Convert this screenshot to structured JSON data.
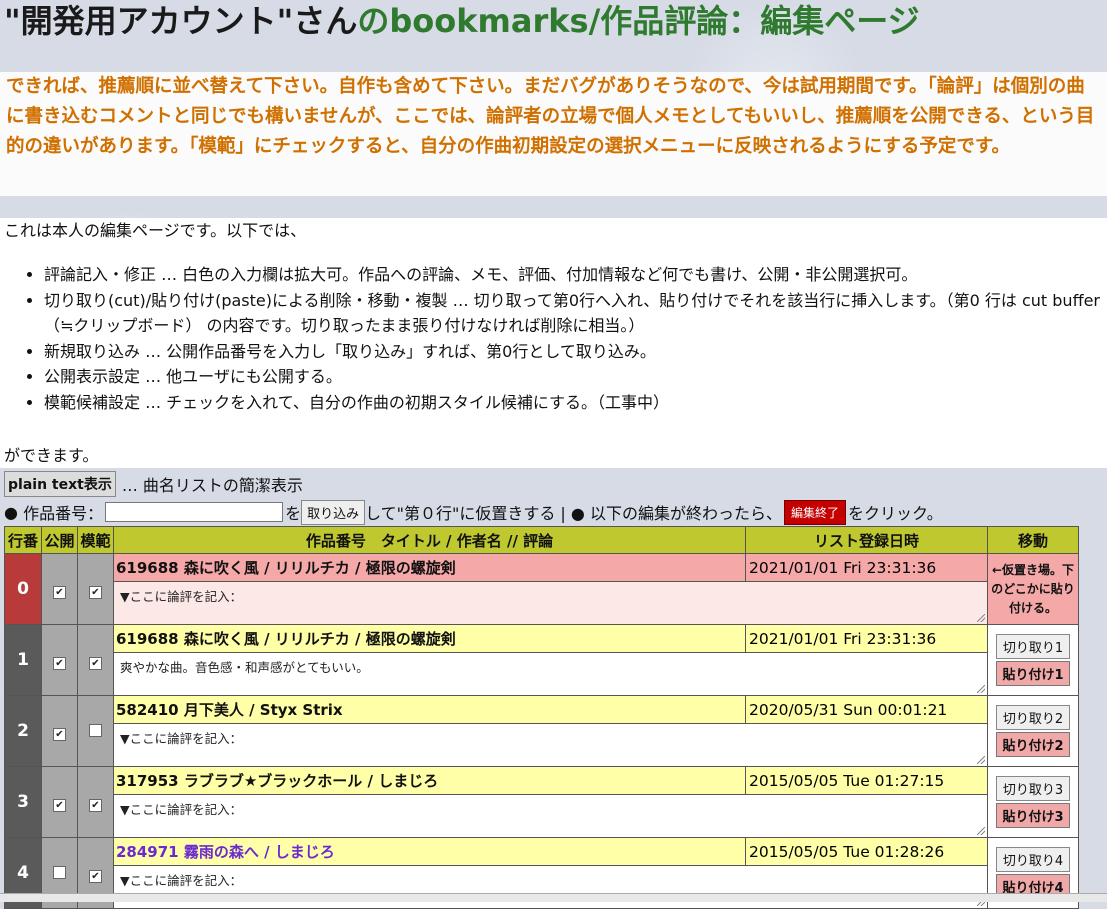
{
  "title": {
    "owner": "\"開発用アカウント\"さん",
    "rest": "のbookmarks/作品評論：編集ページ"
  },
  "notice": "できれば、推薦順に並べ替えて下さい。自作も含めて下さい。まだバグがありそうなので、今は試用期間です。「論評」は個別の曲に書き込むコメントと同じでも構いませんが、ここでは、論評者の立場で個人メモとしてもいいし、推薦順を公開できる、という目的の違いがあります。「模範」にチェックすると、自分の作曲初期設定の選択メニューに反映されるようにする予定です。",
  "intro": {
    "lead": "これは本人の編集ページです。以下では、",
    "items": [
      "評論記入・修正 … 白色の入力欄は拡大可。作品への評論、メモ、評価、付加情報など何でも書け、公開・非公開選択可。",
      "切り取り(cut)/貼り付け(paste)による削除・移動・複製 … 切り取って第0行へ入れ、貼り付けでそれを該当行に挿入します。（第0 行は cut buffer （≒クリップボード） の内容です。切り取ったまま張り付けなければ削除に相当。）",
      "新規取り込み … 公開作品番号を入力し「取り込み」すれば、第0行として取り込み。",
      "公開表示設定 … 他ユーザにも公開する。",
      "模範候補設定 … チェックを入れて、自分の作曲の初期スタイル候補にする。（工事中）"
    ],
    "tail": "ができます。"
  },
  "plain": {
    "button": "plain text表示",
    "desc": "… 曲名リストの簡潔表示"
  },
  "inputrow": {
    "bullet1": "●",
    "label": "作品番号：",
    "after_input": "を",
    "import_button": "取り込み",
    "mid": "して\"第０行\"に仮置きする | ●",
    "finish_prefix": "以下の編集が終わったら、",
    "finish_button": "編集終了",
    "finish_suffix": "をクリック。"
  },
  "table": {
    "headers": [
      "行番",
      "公開",
      "模範",
      "作品番号　タイトル / 作者名 // 評論",
      "リスト登録日時",
      "移動"
    ],
    "hold_note": "←仮置き場。下のどこかに貼り付ける。",
    "rows": [
      {
        "num": "0",
        "pub": "✔",
        "model": "✔",
        "song": "619688 森に吹く風 / リリルチカ / 極限の螺旋剣",
        "date": "2021/01/01 Fri 23:31:36",
        "comment": "▼ここに論評を記入：",
        "cut": "",
        "paste": ""
      },
      {
        "num": "1",
        "pub": "✔",
        "model": "✔",
        "song": "619688 森に吹く風 / リリルチカ / 極限の螺旋剣",
        "date": "2021/01/01 Fri 23:31:36",
        "comment": "爽やかな曲。音色感・和声感がとてもいい。",
        "cut": "切り取り1",
        "paste": "貼り付け1"
      },
      {
        "num": "2",
        "pub": "✔",
        "model": "",
        "song": "582410 月下美人 / Styx Strix",
        "date": "2020/05/31 Sun 00:01:21",
        "comment": "▼ここに論評を記入：",
        "cut": "切り取り2",
        "paste": "貼り付け2"
      },
      {
        "num": "3",
        "pub": "✔",
        "model": "✔",
        "song": "317953 ラブラブ★ブラックホール / しまじろ",
        "date": "2015/05/05 Tue 01:27:15",
        "comment": "▼ここに論評を記入：",
        "cut": "切り取り3",
        "paste": "貼り付け3"
      },
      {
        "num": "4",
        "pub": "",
        "model": "✔",
        "song": "284971 霧雨の森へ / しまじろ",
        "date": "2015/05/05 Tue 01:28:26",
        "comment": "▼ここに論評を記入：",
        "cut": "切り取り4",
        "paste": "貼り付け4"
      }
    ]
  },
  "colors": {
    "header": "#c0c830",
    "row0_num": "#b83a3a",
    "row0_bg": "#f4a8a8",
    "row0_comment": "#fde8e8",
    "row_head_bg": "#ffffa8",
    "num_bg": "#5a5a5a",
    "chk_bg": "#a8a8a8",
    "title_green": "#2f7a2f",
    "notice_orange": "#d07000",
    "song4_link": "#6a2ad0"
  }
}
